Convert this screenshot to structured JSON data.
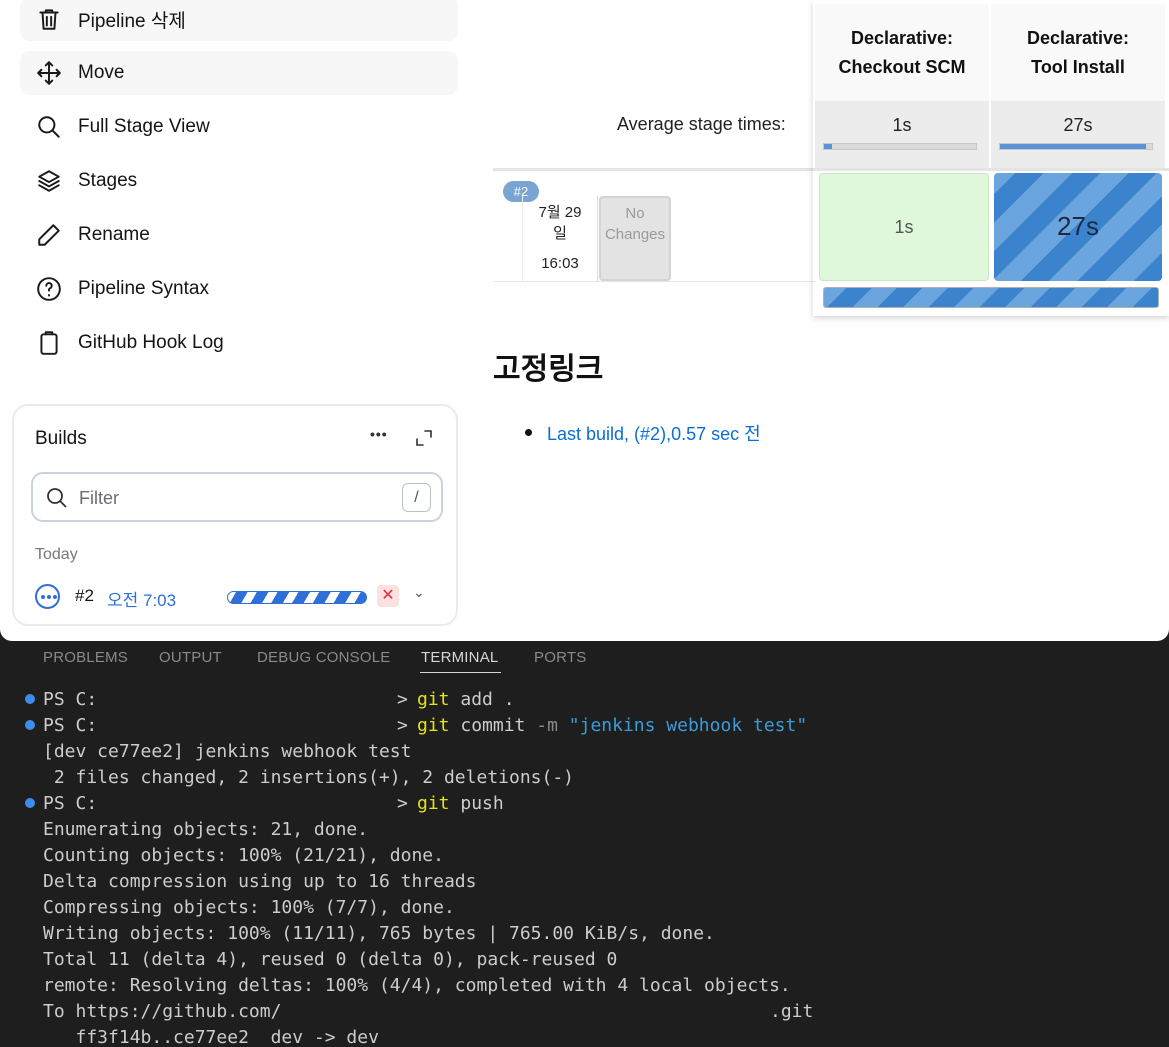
{
  "sidebar": {
    "items": [
      {
        "label": "Pipeline 삭제",
        "icon": "trash-icon"
      },
      {
        "label": "Move",
        "icon": "move-icon"
      },
      {
        "label": "Full Stage View",
        "icon": "search-icon"
      },
      {
        "label": "Stages",
        "icon": "layers-icon"
      },
      {
        "label": "Rename",
        "icon": "pencil-icon"
      },
      {
        "label": "Pipeline Syntax",
        "icon": "help-circle-icon"
      },
      {
        "label": "GitHub Hook Log",
        "icon": "clipboard-icon"
      }
    ]
  },
  "builds": {
    "title": "Builds",
    "more": "•••",
    "filter_placeholder": "Filter",
    "filter_shortcut": "/",
    "group": "Today",
    "entries": [
      {
        "number": "#2",
        "time": "오전 7:03",
        "status": "running",
        "stop": "✕",
        "expand": "⌄"
      }
    ]
  },
  "stage_view": {
    "columns": [
      {
        "name": "Declarative: Checkout SCM",
        "line1": "Declarative:",
        "line2": "Checkout SCM",
        "avg": "1s",
        "avg_progress": 0.05
      },
      {
        "name": "Declarative: Tool Install",
        "line1": "Declarative:",
        "line2": "Tool Install",
        "avg": "27s",
        "avg_progress": 0.96
      }
    ],
    "average_label": "Average stage times:",
    "run": {
      "badge": "#2",
      "date_line1": "7월 29",
      "date_line2": "일",
      "time": "16:03",
      "changes_line1": "No",
      "changes_line2": "Changes",
      "cells": [
        "1s",
        "27s"
      ]
    }
  },
  "permalinks": {
    "title": "고정링크",
    "items": [
      "Last build, (#2),0.57 sec 전"
    ]
  },
  "panel": {
    "tabs": [
      "PROBLEMS",
      "OUTPUT",
      "DEBUG CONSOLE",
      "TERMINAL",
      "PORTS"
    ],
    "active_tab": "TERMINAL"
  },
  "terminal": {
    "prompt": "PS C:",
    "prompt_end": ">",
    "cmd1": {
      "git": "git",
      "rest": "add ."
    },
    "cmd2": {
      "git": "git",
      "rest": "commit",
      "flag": "-m",
      "str": "\"jenkins webhook test\""
    },
    "cmd3": {
      "git": "git",
      "rest": "push"
    },
    "out_commit": [
      "[dev ce77ee2] jenkins webhook test",
      " 2 files changed, 2 insertions(+), 2 deletions(-)"
    ],
    "out_push": [
      "Enumerating objects: 21, done.",
      "Counting objects: 100% (21/21), done.",
      "Delta compression using up to 16 threads",
      "Compressing objects: 100% (7/7), done.",
      "Writing objects: 100% (11/11), 765 bytes | 765.00 KiB/s, done.",
      "Total 11 (delta 4), reused 0 (delta 0), pack-reused 0",
      "remote: Resolving deltas: 100% (4/4), completed with 4 local objects."
    ],
    "remote_to": "To https://github.com/",
    "remote_suffix": ".git",
    "ref_update": "   ff3f14b..ce77ee2  dev -> dev"
  },
  "colors": {
    "link": "#0b6ed6",
    "running_blue": "#2e6fd8",
    "success_cell": "#dff8dc",
    "terminal_bg": "#1e1e1e",
    "git_keyword": "#e5e510",
    "string": "#3b9bd9"
  }
}
